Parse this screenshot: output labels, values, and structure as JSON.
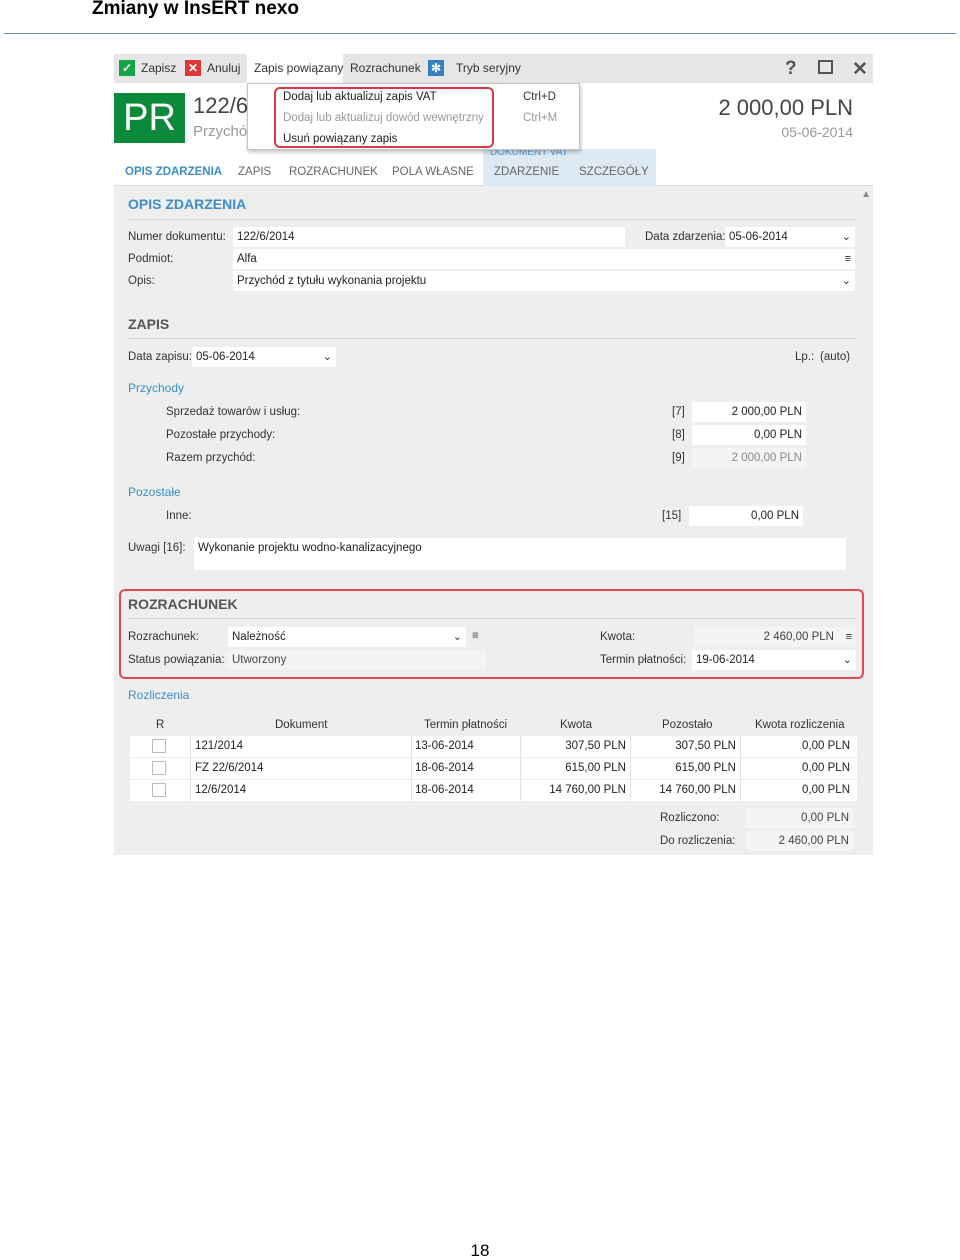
{
  "document": {
    "title": "Zmiany w InsERT nexo",
    "page_number": "18"
  },
  "toolbar": {
    "save": "Zapisz",
    "cancel": "Anuluj",
    "linked_entry": "Zapis powiązany",
    "settlement": "Rozrachunek",
    "serial_mode": "Tryb seryjny",
    "help": "?"
  },
  "dropdown": {
    "items": [
      {
        "label": "Dodaj lub aktualizuj zapis VAT",
        "shortcut": "Ctrl+D"
      },
      {
        "label": "Dodaj lub aktualizuj dowód wewnętrzny",
        "shortcut": "Ctrl+M"
      },
      {
        "label": "Usuń powiązany zapis",
        "shortcut": ""
      }
    ]
  },
  "header": {
    "badge": "PR",
    "number": "122/6",
    "type": "Przychó",
    "amount": "2 000,00 PLN",
    "date": "05-06-2014"
  },
  "tabs": {
    "group_label": "DOKUMENT VAT",
    "items": [
      "OPIS ZDARZENIA",
      "ZAPIS",
      "ROZRACHUNEK",
      "POLA WŁASNE",
      "ZDARZENIE",
      "SZCZEGÓŁY"
    ]
  },
  "opis": {
    "title": "OPIS ZDARZENIA",
    "doc_number_label": "Numer dokumentu:",
    "doc_number": "122/6/2014",
    "event_date_label": "Data zdarzenia:",
    "event_date": "05-06-2014",
    "entity_label": "Podmiot:",
    "entity": "Alfa",
    "desc_label": "Opis:",
    "desc": "Przychód z tytułu wykonania projektu"
  },
  "zapis": {
    "title": "ZAPIS",
    "entry_date_label": "Data zapisu:",
    "entry_date": "05-06-2014",
    "lp_label": "Lp.:",
    "lp_value": "(auto)",
    "income_title": "Przychody",
    "sales_label": "Sprzedaż towarów i usług:",
    "sales_code": "[7]",
    "sales_value": "2 000,00 PLN",
    "other_income_label": "Pozostałe przychody:",
    "other_income_code": "[8]",
    "other_income_value": "0,00 PLN",
    "total_label": "Razem przychód:",
    "total_code": "[9]",
    "total_value": "2 000,00 PLN",
    "other_title": "Pozostałe",
    "misc_label": "Inne:",
    "misc_code": "[15]",
    "misc_value": "0,00 PLN",
    "notes_label": "Uwagi [16]:",
    "notes_value": "Wykonanie projektu wodno-kanalizacyjnego"
  },
  "rozrachunek": {
    "title": "ROZRACHUNEK",
    "settlement_label": "Rozrachunek:",
    "settlement_value": "Należność",
    "amount_label": "Kwota:",
    "amount_value": "2 460,00 PLN",
    "status_label": "Status powiązania:",
    "status_value": "Utworzony",
    "due_label": "Termin płatności:",
    "due_value": "19-06-2014"
  },
  "rozliczenia": {
    "title": "Rozliczenia",
    "columns": [
      "R",
      "Dokument",
      "Termin płatności",
      "Kwota",
      "Pozostało",
      "Kwota rozliczenia"
    ],
    "rows": [
      {
        "doc": "121/2014",
        "due": "13-06-2014",
        "amount": "307,50 PLN",
        "remaining": "307,50 PLN",
        "settled": "0,00 PLN"
      },
      {
        "doc": "FZ 22/6/2014",
        "due": "18-06-2014",
        "amount": "615,00 PLN",
        "remaining": "615,00 PLN",
        "settled": "0,00 PLN"
      },
      {
        "doc": "12/6/2014",
        "due": "18-06-2014",
        "amount": "14 760,00 PLN",
        "remaining": "14 760,00 PLN",
        "settled": "0,00 PLN"
      }
    ],
    "settled_label": "Rozliczono:",
    "settled_value": "0,00 PLN",
    "to_settle_label": "Do rozliczenia:",
    "to_settle_value": "2 460,00 PLN"
  },
  "colors": {
    "accent": "#3b8ec8",
    "badge_green": "#0c8a3c",
    "highlight_red": "#e04854"
  }
}
